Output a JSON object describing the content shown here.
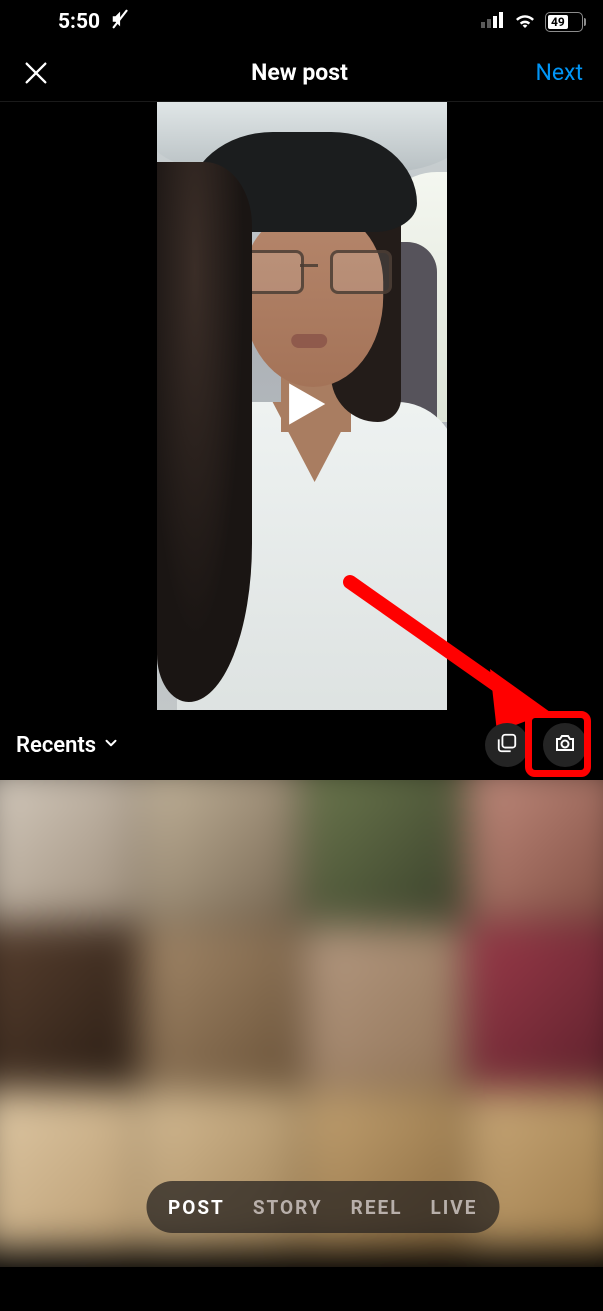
{
  "status": {
    "time": "5:50",
    "battery": "49"
  },
  "header": {
    "title": "New post",
    "next": "Next"
  },
  "toolbar": {
    "album": "Recents"
  },
  "modes": {
    "post": "POST",
    "story": "STORY",
    "reel": "REEL",
    "live": "LIVE"
  },
  "colors": {
    "accent": "#0095f6",
    "annotation": "#ff0000"
  }
}
